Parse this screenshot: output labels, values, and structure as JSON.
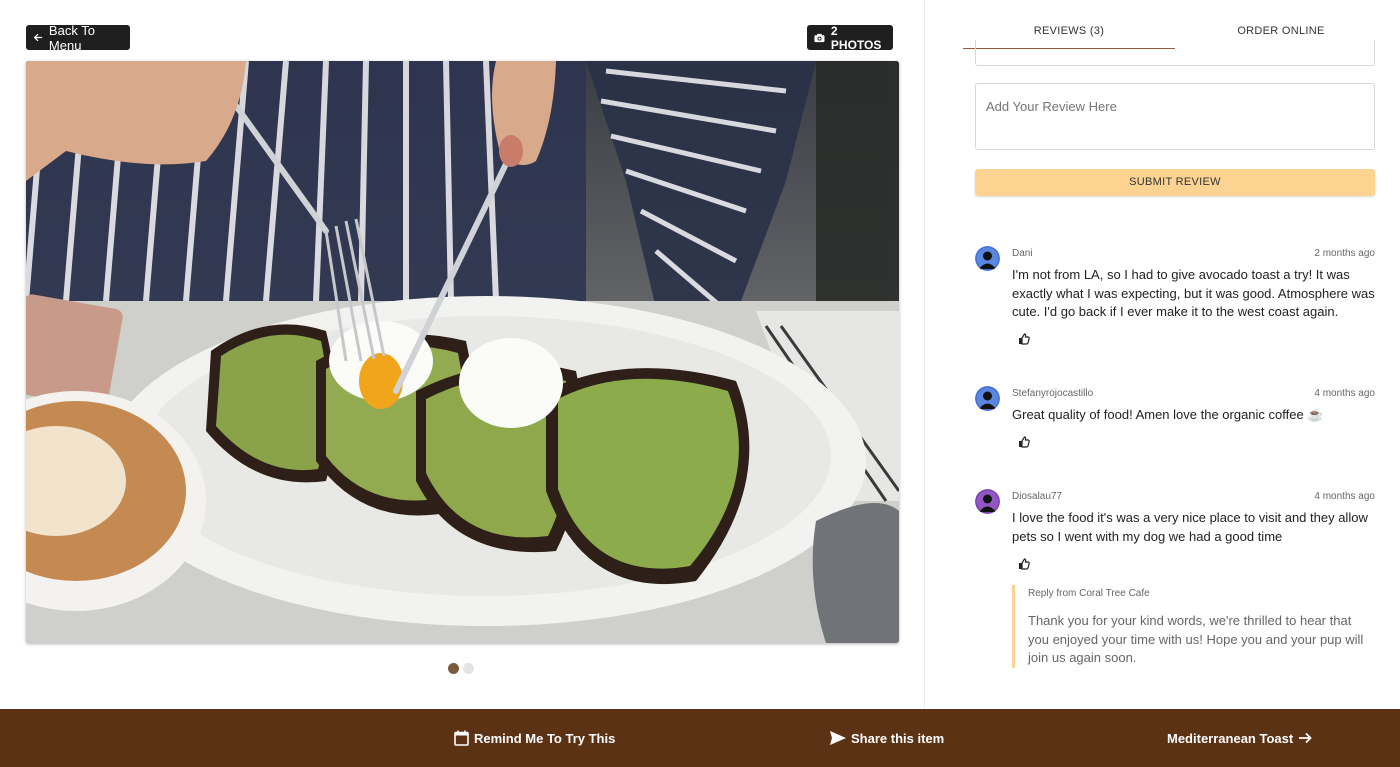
{
  "left": {
    "back_label": "Back To Menu",
    "photos_label": "2 PHOTOS",
    "photo_count": 2,
    "current_photo": 1
  },
  "tabs": [
    {
      "label": "REVIEWS (3)",
      "active": true
    },
    {
      "label": "ORDER ONLINE",
      "active": false
    }
  ],
  "review_form": {
    "placeholder": "Add Your Review Here",
    "submit_label": "SUBMIT REVIEW"
  },
  "reviews": [
    {
      "name": "Dani",
      "time": "2 months ago",
      "text": "I'm not from LA, so I had to give avocado toast a try! It was exactly what I was expecting, but it was good. Atmosphere was cute. I'd go back if I ever make it to the west coast again."
    },
    {
      "name": "Stefanyrojocastillo",
      "time": "4 months ago",
      "text": "Great quality of food! Amen love the organic coffee ☕"
    },
    {
      "name": "Diosalau77",
      "time": "4 months ago",
      "text": "I love the food it's was a very nice place to visit and they allow pets so I went with my dog we had a good time",
      "reply": {
        "from": "Reply from Coral Tree Cafe",
        "text": "Thank you for your kind words, we're thrilled to hear that you enjoyed your time with us! Hope you and your pup will join us again soon."
      }
    }
  ],
  "footer": {
    "remind_label": "Remind Me To Try This",
    "share_label": "Share this item",
    "next_label": "Mediterranean Toast"
  },
  "colors": {
    "footer_bg": "#5c3214",
    "submit_bg": "#fdd391",
    "tab_underline": "#9a5a3b",
    "dot_active": "#7a5c3c",
    "avatar_blue": "#3f6fd6",
    "avatar_purple": "#7a3fb0"
  }
}
